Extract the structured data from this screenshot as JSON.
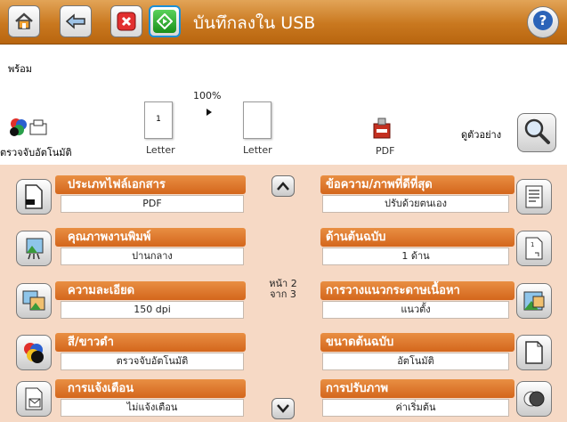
{
  "header": {
    "title": "บันทึกลงใน USB",
    "home_icon": "home-icon",
    "back_icon": "back-icon",
    "stop_icon": "stop-icon",
    "start_icon": "start-icon",
    "help_icon": "help-icon"
  },
  "status": "พร้อม",
  "preview": {
    "zoom": "100%",
    "page1_number": "1",
    "page1_label": "Letter",
    "page2_label": "Letter",
    "autodetect_label": "ตรวจจับอัตโนมัติ",
    "file_type_label": "PDF",
    "preview_label": "ดูตัวอย่าง"
  },
  "pager": {
    "page_line": "หน้า 2",
    "of_line": "จาก 3"
  },
  "settings_left": [
    {
      "label": "ประเภทไฟล์เอกสาร",
      "value": "PDF",
      "icon": "document-file-icon"
    },
    {
      "label": "คุณภาพงานพิมพ์",
      "value": "ปานกลาง",
      "icon": "print-quality-icon"
    },
    {
      "label": "ความละเอียด",
      "value": "150 dpi",
      "icon": "resolution-icon"
    },
    {
      "label": "สี/ขาวดำ",
      "value": "ตรวจจับอัตโนมัติ",
      "icon": "color-icon"
    },
    {
      "label": "การแจ้งเตือน",
      "value": "ไม่แจ้งเตือน",
      "icon": "notification-icon"
    }
  ],
  "settings_right": [
    {
      "label": "ข้อความ/ภาพที่ดีที่สุด",
      "value": "ปรับด้วยตนเอง",
      "icon": "text-image-icon"
    },
    {
      "label": "ด้านต้นฉบับ",
      "value": "1 ด้าน",
      "icon": "original-sides-icon"
    },
    {
      "label": "การวางแนวกระดาษเนื้อหา",
      "value": "แนวตั้ง",
      "icon": "orientation-icon"
    },
    {
      "label": "ขนาดต้นฉบับ",
      "value": "อัตโนมัติ",
      "icon": "original-size-icon"
    },
    {
      "label": "การปรับภาพ",
      "value": "ค่าเริ่มต้น",
      "icon": "image-adjust-icon"
    }
  ]
}
